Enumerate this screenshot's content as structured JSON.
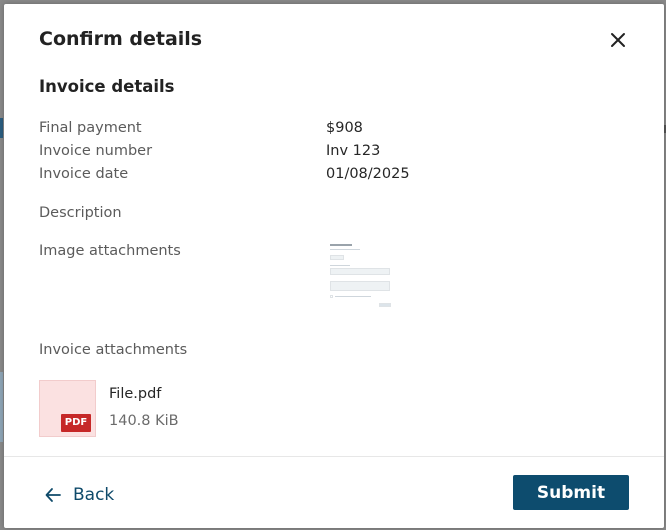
{
  "dialog": {
    "title": "Confirm details",
    "close_icon": "close-icon"
  },
  "invoice": {
    "section_title": "Invoice details",
    "final_payment_label": "Final payment",
    "final_payment_value": "$908",
    "invoice_number_label": "Invoice number",
    "invoice_number_value": "Inv 123",
    "invoice_date_label": "Invoice date",
    "invoice_date_value": "01/08/2025",
    "description_label": "Description",
    "image_attachments_label": "Image attachments",
    "invoice_attachments_label": "Invoice attachments"
  },
  "attachment": {
    "badge": "PDF",
    "file_name": "File.pdf",
    "file_size": "140.8 KiB"
  },
  "footer": {
    "back_label": "Back",
    "submit_label": "Submit"
  },
  "colors": {
    "primary": "#0d4c6e",
    "pdf_badge": "#c62828",
    "pdf_tile": "#fbe1e1"
  }
}
